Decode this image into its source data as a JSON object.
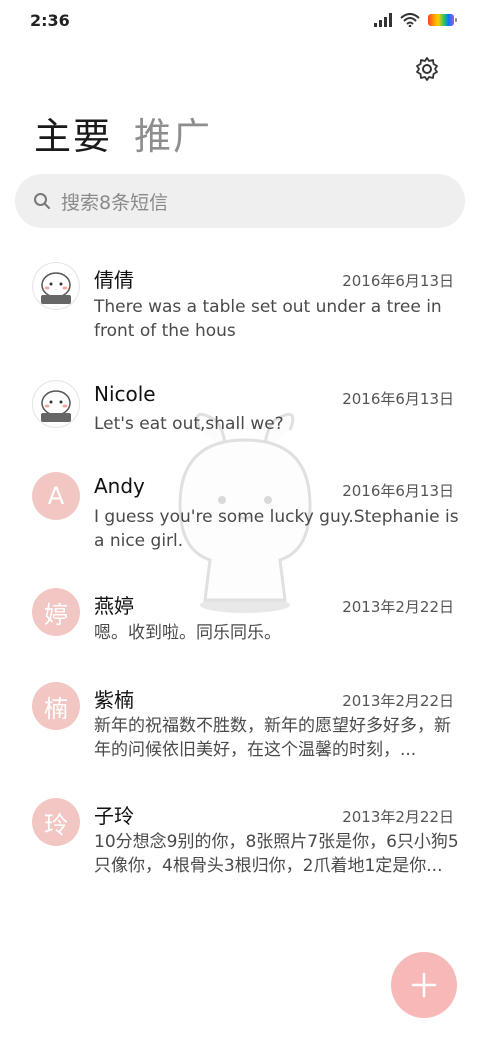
{
  "status_bar": {
    "time": "2:36",
    "icons": [
      "signal-icon",
      "wifi-icon",
      "battery-icon"
    ]
  },
  "header": {
    "settings_icon": "gear-icon"
  },
  "tabs": [
    {
      "label": "主要",
      "active": true
    },
    {
      "label": "推广",
      "active": false
    }
  ],
  "search": {
    "placeholder": "搜索8条短信",
    "icon": "search-icon"
  },
  "conversations": [
    {
      "name": "倩倩",
      "date": "2016年6月13日",
      "preview": "There was a table set out under a tree in front of the hous",
      "avatar_type": "image",
      "avatar_letter": ""
    },
    {
      "name": "Nicole",
      "date": "2016年6月13日",
      "preview": "Let's eat out,shall we?",
      "avatar_type": "image",
      "avatar_letter": ""
    },
    {
      "name": "Andy",
      "date": "2016年6月13日",
      "preview": "I guess you're some lucky guy.Stephanie is a nice girl.",
      "avatar_type": "letter",
      "avatar_letter": "A"
    },
    {
      "name": "燕婷",
      "date": "2013年2月22日",
      "preview": "嗯。收到啦。同乐同乐。",
      "avatar_type": "letter",
      "avatar_letter": "婷"
    },
    {
      "name": "紫楠",
      "date": "2013年2月22日",
      "preview": "新年的祝福数不胜数，新年的愿望好多好多，新年的问候依旧美好，在这个温馨的时刻，...",
      "avatar_type": "letter",
      "avatar_letter": "楠"
    },
    {
      "name": "子玲",
      "date": "2013年2月22日",
      "preview": "10分想念9别的你，8张照片7张是你，6只小狗5只像你，4根骨头3根归你，2爪着地1定是你...",
      "avatar_type": "letter",
      "avatar_letter": "玲"
    }
  ],
  "fab": {
    "icon": "plus-icon"
  },
  "colors": {
    "avatar_bg": "#f2c7c3",
    "fab_bg": "#f7b9b7",
    "search_bg": "#efefef"
  }
}
